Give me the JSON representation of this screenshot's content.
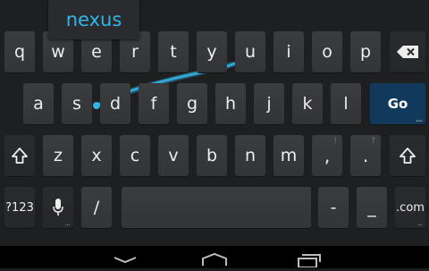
{
  "suggestion": {
    "word": "nexus"
  },
  "rows": {
    "row1": [
      "q",
      "w",
      "e",
      "r",
      "t",
      "y",
      "u",
      "i",
      "o",
      "p"
    ],
    "row2": [
      "a",
      "s",
      "d",
      "f",
      "g",
      "h",
      "j",
      "k",
      "l"
    ],
    "row3": [
      "z",
      "x",
      "c",
      "v",
      "b",
      "n",
      "m",
      "!",
      "?"
    ],
    "row3_hints": {
      "excl": "!",
      "quest": "?"
    }
  },
  "keys": {
    "go": "Go",
    "symbols": "?123",
    "slash": "/",
    "dash": "-",
    "underscore": "_",
    "dotcom": ".com",
    "more_dots": "..."
  },
  "icons": {
    "backspace": "backspace-icon",
    "shift": "shift-icon",
    "mic": "microphone-icon",
    "back": "back-icon",
    "home": "home-icon",
    "recents": "recents-icon"
  },
  "colors": {
    "accent": "#33b5e5",
    "go_key": "#11395b",
    "key": "#3b3c3f"
  }
}
